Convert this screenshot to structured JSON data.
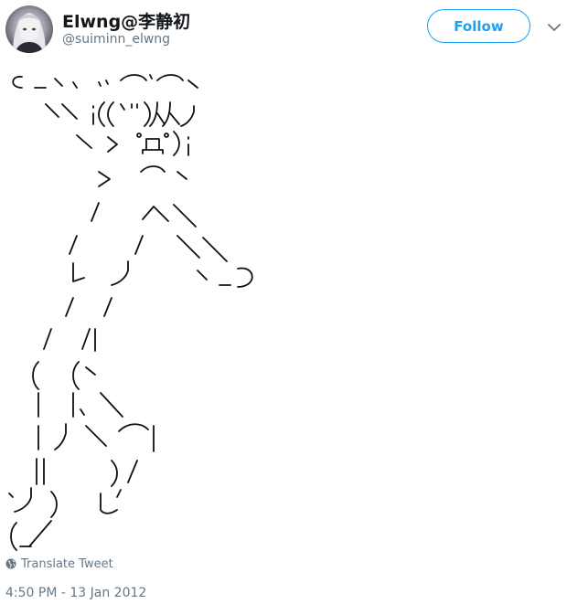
{
  "tweet": {
    "author": {
      "display_name": "Elwng@李静初",
      "handle": "@suiminn_elwng",
      "avatar_icon": "anime-avatar"
    },
    "follow_label": "Follow",
    "menu_icon": "chevron-down-icon",
    "ascii_art": "⊂_ヽ、 〃⌒`⌒ヽ\n　 ＼ ＼i((`\")从ﾉ\n　　 ＼ ＞ ﾟДﾟ)i\n　　　 ＞ ⌒ヽ\n　　 /　 へ＼\n　 /　 /　＼＼\n　 ﾚ　ノ　　 ヽ_つ\n　/　/\n /　/|\n(　(ヽ\n|　|、＼\n| 丿 ＼ ⌒)\n| |　　) /\n`ノ )　 Lﾉ\n(_／",
    "translate_label": "Translate Tweet",
    "translate_icon": "globe-icon",
    "timestamp": "4:50 PM - 13 Jan 2012"
  },
  "colors": {
    "accent": "#1da1f2",
    "secondary_text": "#657786",
    "primary_text": "#14171a"
  }
}
